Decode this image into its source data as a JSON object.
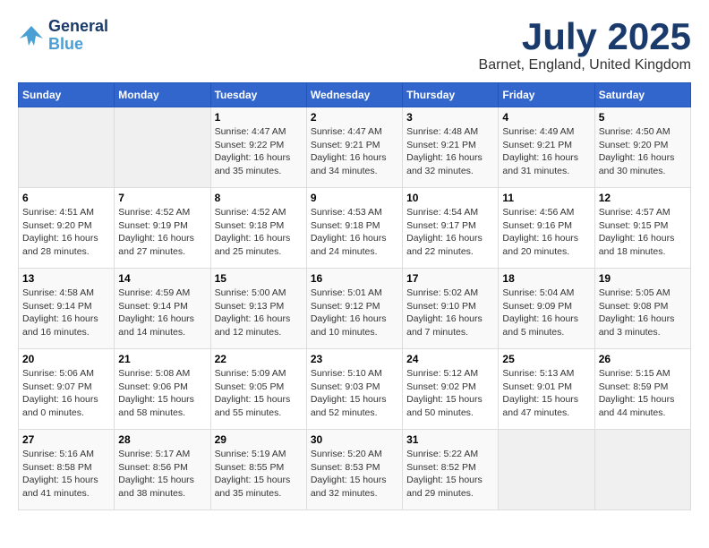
{
  "header": {
    "logo_line1": "General",
    "logo_line2": "Blue",
    "month_title": "July 2025",
    "location": "Barnet, England, United Kingdom"
  },
  "weekdays": [
    "Sunday",
    "Monday",
    "Tuesday",
    "Wednesday",
    "Thursday",
    "Friday",
    "Saturday"
  ],
  "weeks": [
    [
      {
        "day": "",
        "info": ""
      },
      {
        "day": "",
        "info": ""
      },
      {
        "day": "1",
        "info": "Sunrise: 4:47 AM\nSunset: 9:22 PM\nDaylight: 16 hours and 35 minutes."
      },
      {
        "day": "2",
        "info": "Sunrise: 4:47 AM\nSunset: 9:21 PM\nDaylight: 16 hours and 34 minutes."
      },
      {
        "day": "3",
        "info": "Sunrise: 4:48 AM\nSunset: 9:21 PM\nDaylight: 16 hours and 32 minutes."
      },
      {
        "day": "4",
        "info": "Sunrise: 4:49 AM\nSunset: 9:21 PM\nDaylight: 16 hours and 31 minutes."
      },
      {
        "day": "5",
        "info": "Sunrise: 4:50 AM\nSunset: 9:20 PM\nDaylight: 16 hours and 30 minutes."
      }
    ],
    [
      {
        "day": "6",
        "info": "Sunrise: 4:51 AM\nSunset: 9:20 PM\nDaylight: 16 hours and 28 minutes."
      },
      {
        "day": "7",
        "info": "Sunrise: 4:52 AM\nSunset: 9:19 PM\nDaylight: 16 hours and 27 minutes."
      },
      {
        "day": "8",
        "info": "Sunrise: 4:52 AM\nSunset: 9:18 PM\nDaylight: 16 hours and 25 minutes."
      },
      {
        "day": "9",
        "info": "Sunrise: 4:53 AM\nSunset: 9:18 PM\nDaylight: 16 hours and 24 minutes."
      },
      {
        "day": "10",
        "info": "Sunrise: 4:54 AM\nSunset: 9:17 PM\nDaylight: 16 hours and 22 minutes."
      },
      {
        "day": "11",
        "info": "Sunrise: 4:56 AM\nSunset: 9:16 PM\nDaylight: 16 hours and 20 minutes."
      },
      {
        "day": "12",
        "info": "Sunrise: 4:57 AM\nSunset: 9:15 PM\nDaylight: 16 hours and 18 minutes."
      }
    ],
    [
      {
        "day": "13",
        "info": "Sunrise: 4:58 AM\nSunset: 9:14 PM\nDaylight: 16 hours and 16 minutes."
      },
      {
        "day": "14",
        "info": "Sunrise: 4:59 AM\nSunset: 9:14 PM\nDaylight: 16 hours and 14 minutes."
      },
      {
        "day": "15",
        "info": "Sunrise: 5:00 AM\nSunset: 9:13 PM\nDaylight: 16 hours and 12 minutes."
      },
      {
        "day": "16",
        "info": "Sunrise: 5:01 AM\nSunset: 9:12 PM\nDaylight: 16 hours and 10 minutes."
      },
      {
        "day": "17",
        "info": "Sunrise: 5:02 AM\nSunset: 9:10 PM\nDaylight: 16 hours and 7 minutes."
      },
      {
        "day": "18",
        "info": "Sunrise: 5:04 AM\nSunset: 9:09 PM\nDaylight: 16 hours and 5 minutes."
      },
      {
        "day": "19",
        "info": "Sunrise: 5:05 AM\nSunset: 9:08 PM\nDaylight: 16 hours and 3 minutes."
      }
    ],
    [
      {
        "day": "20",
        "info": "Sunrise: 5:06 AM\nSunset: 9:07 PM\nDaylight: 16 hours and 0 minutes."
      },
      {
        "day": "21",
        "info": "Sunrise: 5:08 AM\nSunset: 9:06 PM\nDaylight: 15 hours and 58 minutes."
      },
      {
        "day": "22",
        "info": "Sunrise: 5:09 AM\nSunset: 9:05 PM\nDaylight: 15 hours and 55 minutes."
      },
      {
        "day": "23",
        "info": "Sunrise: 5:10 AM\nSunset: 9:03 PM\nDaylight: 15 hours and 52 minutes."
      },
      {
        "day": "24",
        "info": "Sunrise: 5:12 AM\nSunset: 9:02 PM\nDaylight: 15 hours and 50 minutes."
      },
      {
        "day": "25",
        "info": "Sunrise: 5:13 AM\nSunset: 9:01 PM\nDaylight: 15 hours and 47 minutes."
      },
      {
        "day": "26",
        "info": "Sunrise: 5:15 AM\nSunset: 8:59 PM\nDaylight: 15 hours and 44 minutes."
      }
    ],
    [
      {
        "day": "27",
        "info": "Sunrise: 5:16 AM\nSunset: 8:58 PM\nDaylight: 15 hours and 41 minutes."
      },
      {
        "day": "28",
        "info": "Sunrise: 5:17 AM\nSunset: 8:56 PM\nDaylight: 15 hours and 38 minutes."
      },
      {
        "day": "29",
        "info": "Sunrise: 5:19 AM\nSunset: 8:55 PM\nDaylight: 15 hours and 35 minutes."
      },
      {
        "day": "30",
        "info": "Sunrise: 5:20 AM\nSunset: 8:53 PM\nDaylight: 15 hours and 32 minutes."
      },
      {
        "day": "31",
        "info": "Sunrise: 5:22 AM\nSunset: 8:52 PM\nDaylight: 15 hours and 29 minutes."
      },
      {
        "day": "",
        "info": ""
      },
      {
        "day": "",
        "info": ""
      }
    ]
  ]
}
